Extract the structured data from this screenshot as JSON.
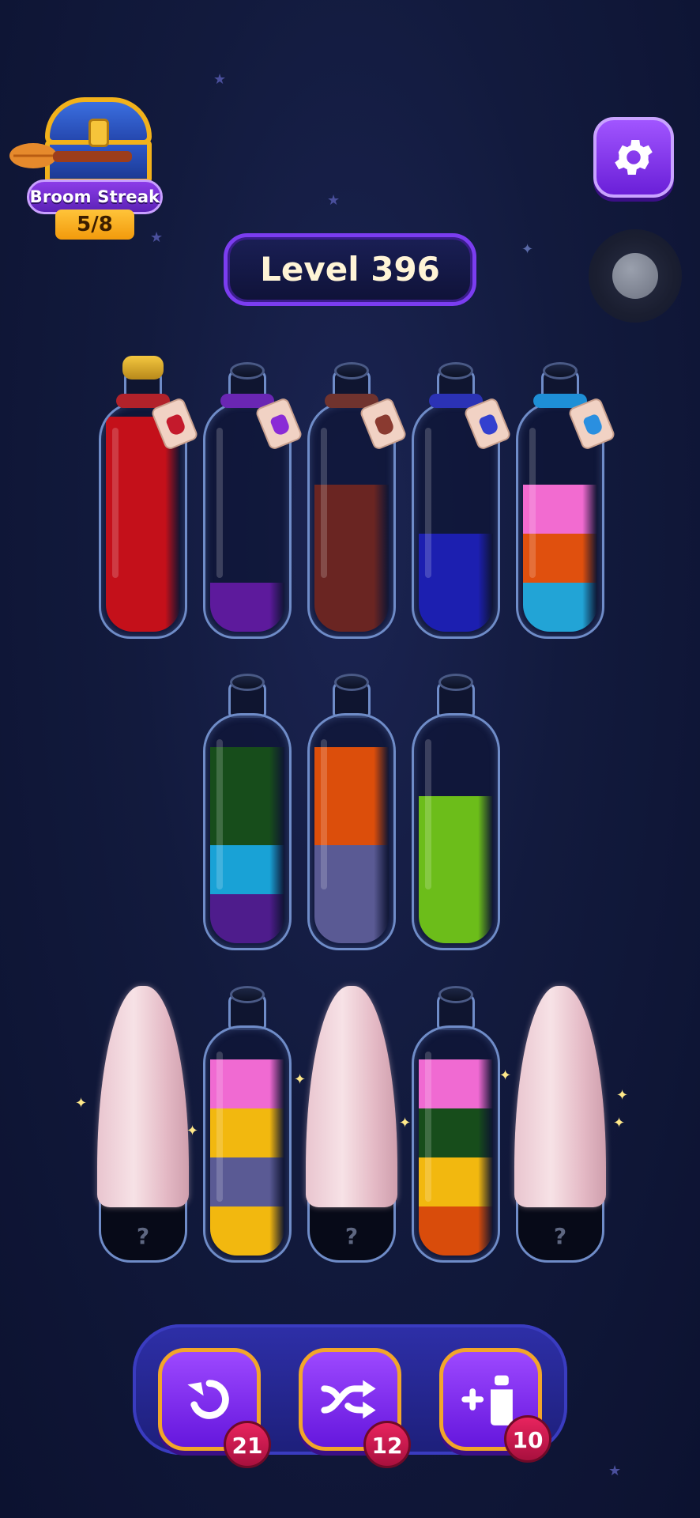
{
  "streak": {
    "title": "Broom Streak",
    "count": "5/8"
  },
  "level": {
    "label": "Level 396"
  },
  "bottles_row1": [
    {
      "id": "red",
      "layers": [
        "#c4101a",
        "#c4101a",
        "#c4101a",
        "#c4101a"
      ],
      "rope": "#b2222a",
      "tag_color": "#c41a2c",
      "corked": true
    },
    {
      "id": "purple",
      "layers": [
        "#5d1a9c"
      ],
      "rope": "#6a26b3",
      "tag_color": "#8a2bd6",
      "corked": false
    },
    {
      "id": "brown",
      "layers": [
        "#6a2522",
        "#6a2522",
        "#6a2522"
      ],
      "rope": "#70332e",
      "tag_color": "#8a3a30",
      "corked": false
    },
    {
      "id": "blue",
      "layers": [
        "#1c1fb0",
        "#1c1fb0"
      ],
      "rope": "#2b32b5",
      "tag_color": "#3340cf",
      "corked": false
    },
    {
      "id": "mixed",
      "layers": [
        "#22a4d6",
        "#e0500e",
        "#f26bd0"
      ],
      "rope": "#1e8fd6",
      "tag_color": "#2a8fe0",
      "corked": false
    }
  ],
  "bottles_row2": [
    {
      "id": "g-c-p",
      "layers": [
        "#4e1c8c",
        "#19a2d6",
        "#174d1b",
        "#174d1b"
      ]
    },
    {
      "id": "s-o",
      "layers": [
        "#5a5a94",
        "#5a5a94",
        "#dc4e0b",
        "#dc4e0b"
      ]
    },
    {
      "id": "lime",
      "layers": [
        "#6cbd1a",
        "#6cbd1a",
        "#6cbd1a"
      ]
    }
  ],
  "bottles_row3": [
    {
      "id": "covered-1",
      "covered": true,
      "hint": "?"
    },
    {
      "id": "mix-yellow",
      "layers": [
        "#f2b80f",
        "#5a5a94",
        "#f2b80f",
        "#f06ad2"
      ]
    },
    {
      "id": "covered-2",
      "covered": true,
      "hint": "?"
    },
    {
      "id": "mix-orange",
      "layers": [
        "#d94c0b",
        "#f2b80f",
        "#174d1b",
        "#f06ad2"
      ]
    },
    {
      "id": "covered-3",
      "covered": true,
      "hint": "?"
    }
  ],
  "tools": [
    {
      "name": "undo",
      "count": "21",
      "icon": "undo-icon"
    },
    {
      "name": "shuffle",
      "count": "12",
      "icon": "shuffle-icon"
    },
    {
      "name": "add-bottle",
      "count": "10",
      "icon": "add-bottle-icon"
    }
  ]
}
